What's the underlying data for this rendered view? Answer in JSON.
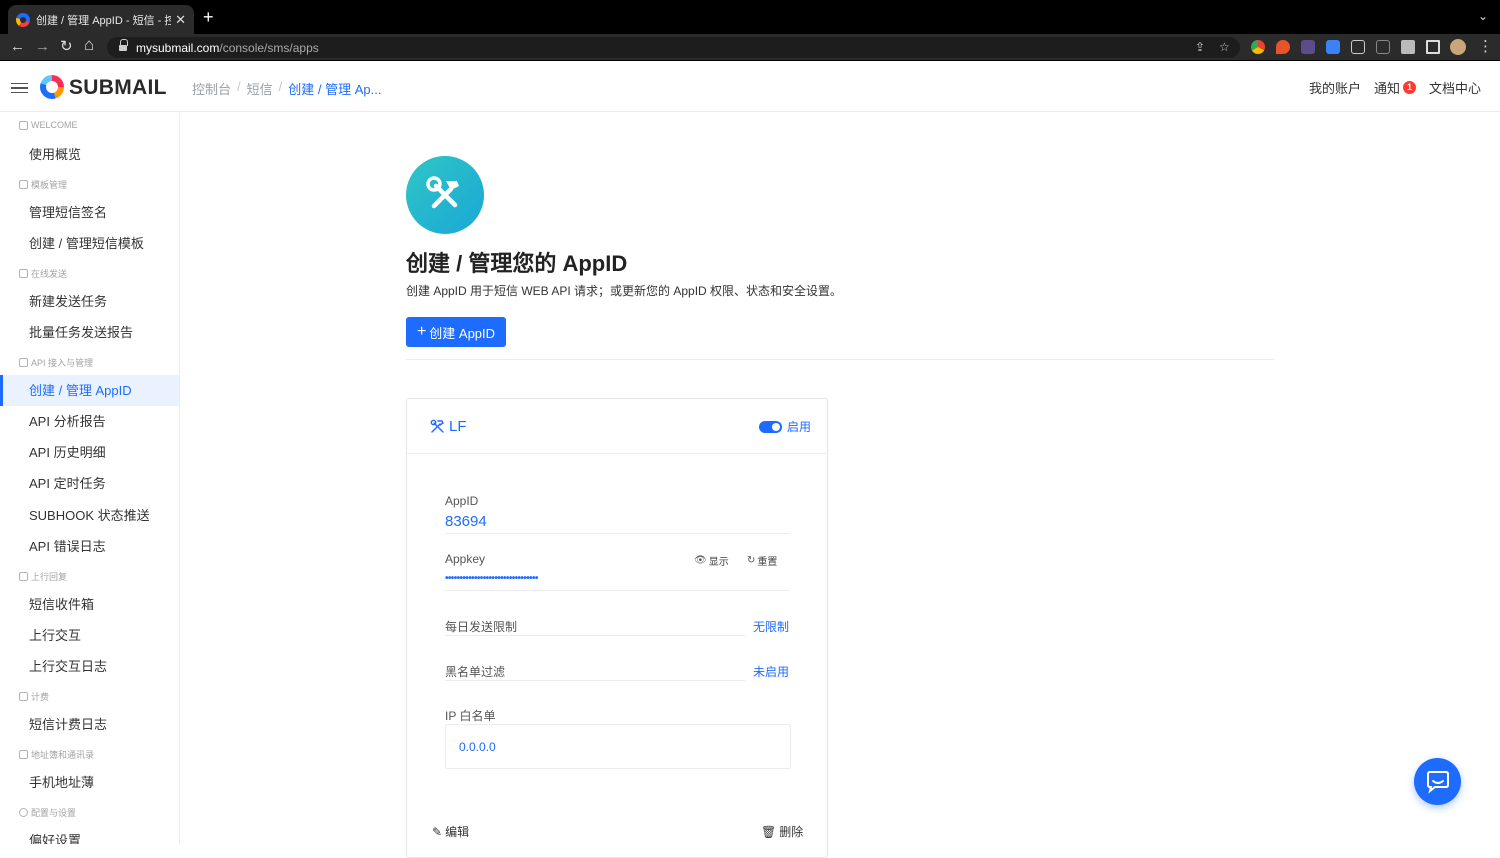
{
  "browser": {
    "tab_title": "创建 / 管理 AppID - 短信 - 控制台",
    "tab_close": "✕",
    "new_tab": "+",
    "tab_menu": "⌄",
    "url_host": "mysubmail.com",
    "url_path": "/console/sms/apps",
    "back": "←",
    "forward": "→",
    "reload": "↻",
    "home": "⌂",
    "share_icon": "⇪",
    "star_icon": "☆",
    "menu_dots": "⋮"
  },
  "header": {
    "logo_text": "SUBMAIL",
    "breadcrumb": [
      "控制台",
      "短信",
      "创建 / 管理 Ap..."
    ],
    "breadcrumb_sep": "/",
    "account": "我的账户",
    "notify": "通知",
    "notify_count": "1",
    "docs": "文档中心"
  },
  "sidebar": {
    "sections": [
      {
        "title": "WELCOME",
        "items": [
          "使用概览"
        ]
      },
      {
        "title": "模板管理",
        "items": [
          "管理短信签名",
          "创建 / 管理短信模板"
        ]
      },
      {
        "title": "在线发送",
        "items": [
          "新建发送任务",
          "批量任务发送报告"
        ]
      },
      {
        "title": "API 接入与管理",
        "items": [
          "创建 / 管理 AppID",
          "API 分析报告",
          "API 历史明细",
          "API 定时任务",
          "SUBHOOK 状态推送",
          "API 错误日志"
        ]
      },
      {
        "title": "上行回复",
        "items": [
          "短信收件箱",
          "上行交互",
          "上行交互日志"
        ]
      },
      {
        "title": "计费",
        "items": [
          "短信计费日志"
        ]
      },
      {
        "title": "地址簿和通讯录",
        "items": [
          "手机地址薄"
        ]
      },
      {
        "title": "配置与设置",
        "items": [
          "偏好设置"
        ]
      }
    ],
    "active_item": "创建 / 管理 AppID"
  },
  "main": {
    "title": "创建 / 管理您的 AppID",
    "description": "创建 AppID 用于短信 WEB API 请求；或更新您的 AppID 权限、状态和安全设置。",
    "create_button": "创建 AppID",
    "create_plus": "+"
  },
  "app_card": {
    "name": "LF",
    "status_label": "启用",
    "status_on": true,
    "appid_label": "AppID",
    "appid_value": "83694",
    "appkey_label": "Appkey",
    "appkey_masked": "••••••••••••••••••••••••••••••••",
    "show_label": "显示",
    "reset_label": "重置",
    "daily_limit_label": "每日发送限制",
    "daily_limit_value": "无限制",
    "blacklist_label": "黑名单过滤",
    "blacklist_value": "未启用",
    "ip_whitelist_label": "IP 白名单",
    "ip_whitelist_value": "0.0.0.0",
    "edit_label": "编辑",
    "delete_label": "删除"
  },
  "colors": {
    "accent": "#1e6bff",
    "hero_teal": "#2ec6c6",
    "badge_red": "#ff3b30"
  }
}
